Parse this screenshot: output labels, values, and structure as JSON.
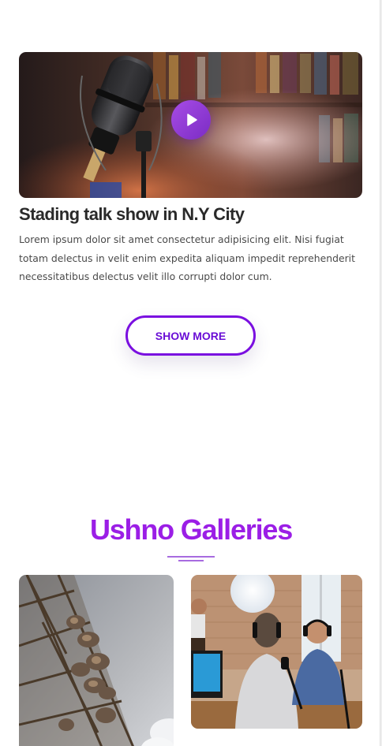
{
  "post": {
    "title": "Stading talk show in N.Y City",
    "body": "Lorem ipsum dolor sit amet consectetur adipisicing elit. Nisi fugiat totam delectus in velit enim expedita aliquam impedit reprehenderit necessitatibus delectus velit illo corrupti dolor cum.",
    "video": {
      "thumbnail": "studio microphone in front of bookshelf",
      "play_icon": "play-icon"
    }
  },
  "show_more": {
    "label": "SHOW MORE"
  },
  "galleries": {
    "heading": "Ushno Galleries",
    "items": [
      {
        "image": "telecom antenna tower"
      },
      {
        "image": "podcast recording studio with two men wearing headphones"
      }
    ]
  },
  "colors": {
    "accent": "#9b1ee6",
    "button_border": "#7a0fe0",
    "play_gradient_start": "#a74ce6",
    "play_gradient_end": "#7b2cc4",
    "title_text": "#2a2a2a",
    "body_text": "#4a4a4a"
  }
}
